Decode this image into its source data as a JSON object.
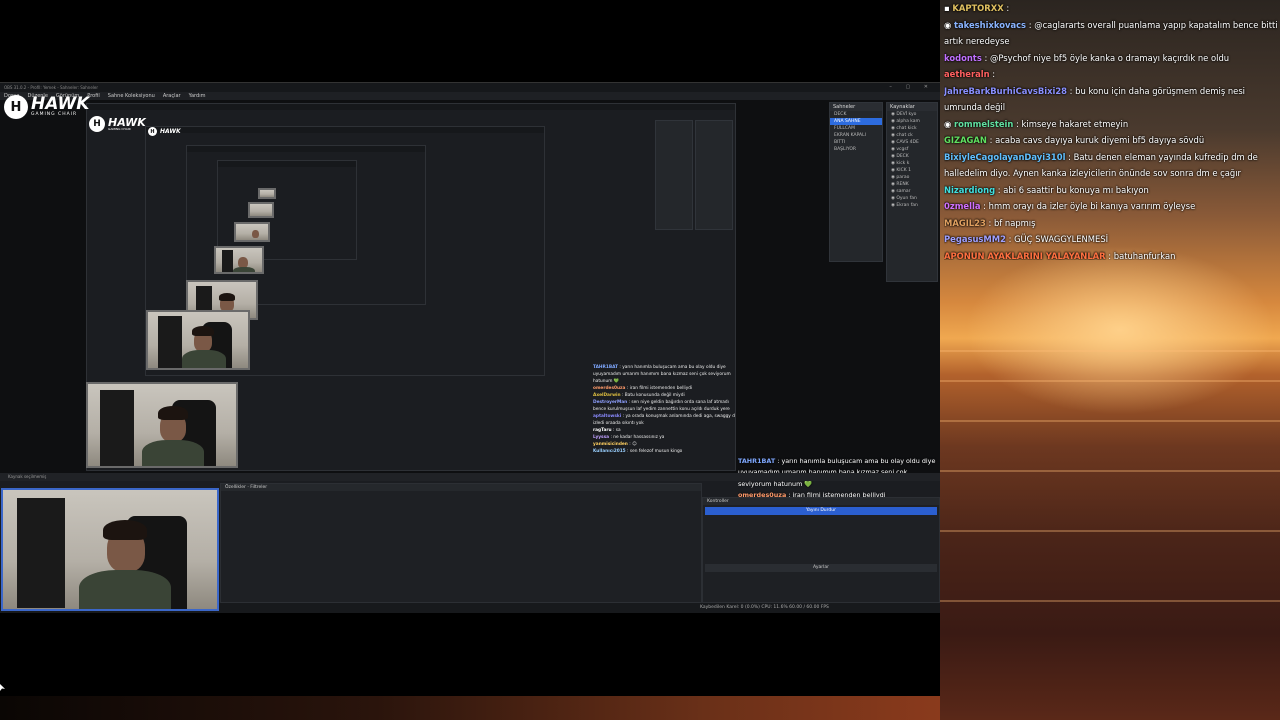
{
  "obs": {
    "title": "OBS 31.0.2 - Profil: Yemek - Sahneler: Sahneler",
    "window_controls": "–  ▢  ✕",
    "menu": [
      "Dosya",
      "Düzenle",
      "Görünüm",
      "Profil",
      "Sahne Koleksiyonu",
      "Araçlar",
      "Yardım"
    ],
    "controls_label": "Kaynak seçilmemiş",
    "dock_sources": "Kaynak seçilmemiş",
    "dock_filters": "Özellikler",
    "dock_filters2": "Filtreler",
    "dock_controls": "Kontroller",
    "status": "Kaybedilen Karel: 0 (0.0%)   CPU: 11.6%   60.00 / 60.00 FPS",
    "dock_record_button": "Yayını Durdur",
    "dock_settings_button": "Ayarlar",
    "scenes_title": "Sahneler",
    "sources_title": "Kaynaklar",
    "scenes": [
      "DECK",
      "ANA SAHNE",
      "FULLCAM",
      "EKRAN KAPALI",
      "BITTI",
      "BAŞLIYOR"
    ],
    "selected_scene_index": 1,
    "sources": [
      "DEVİ kyo",
      "alpha kam",
      "chat kick",
      "chat ck",
      "CAVS 4DE",
      "vcgsf",
      "DECK",
      "kick k",
      "KICK 1",
      "parao",
      "RENK",
      "samar",
      "Oyun fan",
      "Ekran fan"
    ]
  },
  "logo": {
    "name": "HAWK",
    "tagline": "GAMING CHAIR",
    "mark": "H"
  },
  "main_chat": [
    {
      "user": "KAPTORXX",
      "color": "#e0c060",
      "text": "",
      "badge": "▪"
    },
    {
      "user": "takeshixkovacs",
      "color": "#8ab4ff",
      "text": "@caglararts overall puanlama yapıp kapatalım bence bitti artık neredeyse",
      "badge": "◉"
    },
    {
      "user": "kodonts",
      "color": "#c070ff",
      "text": "@Psychof niye bf5 öyle kanka o dramayı kaçırdık ne oldu",
      "badge": ""
    },
    {
      "user": "aetheraln",
      "color": "#ff6060",
      "text": "",
      "badge": ""
    },
    {
      "user": "JahreBarkBurhiCavsBixi28",
      "color": "#8a90ff",
      "text": "bu konu için daha görüşmem demiş nesi umrunda değil",
      "badge": ""
    },
    {
      "user": "rommelstein",
      "color": "#60e0a0",
      "text": "kimseye hakaret etmeyin",
      "badge": "◉"
    },
    {
      "user": "GIZAGAN",
      "color": "#60e060",
      "text": "acaba cavs dayıya kuruk diyemi bf5 dayıya sövdü",
      "badge": ""
    },
    {
      "user": "BixiyleCagolayanDayi310l",
      "color": "#60c0ff",
      "text": "Batu denen eleman yayında kufredip dm de halledelim diyo. Aynen kanka izleyicilerin önünde sov sonra dm e çağır",
      "badge": ""
    },
    {
      "user": "Nizardiong",
      "color": "#40e0e0",
      "text": "abi 6 saattir bu konuya mı bakıyon",
      "badge": ""
    },
    {
      "user": "0zmella",
      "color": "#d070ff",
      "text": "hmm orayı da izler öyle bi kanıya varırım öyleyse",
      "badge": ""
    },
    {
      "user": "MAGIL23",
      "color": "#e0a060",
      "text": "bf napmış",
      "badge": ""
    },
    {
      "user": "PegasusMM2",
      "color": "#a0a0ff",
      "text": "GÜÇ SWAGGYLENMESİ",
      "badge": ""
    },
    {
      "user": "APONUN AYAKLARINI YALAYANLAR",
      "color": "#ff7040",
      "text": "batuhanfurkan",
      "badge": ""
    }
  ],
  "obs_chat": [
    {
      "user": "TAHR1BAT",
      "color": "#7fa8ff",
      "text": "yarın hanımla buluşucam ama bu olay oldu diye uyuyamadım umarım hanımım bana kızmaz seni çok seviyorum hatunum 💚"
    },
    {
      "user": "omerdes0uza",
      "color": "#ff9a6a",
      "text": "iran filmi istemenden belliydi"
    },
    {
      "user": "AxelDarwin",
      "color": "#e0c040",
      "text": "Batu konusunda değil miydi"
    },
    {
      "user": "DestroyerMan",
      "color": "#8fa0ff",
      "text": "sen niye geldin bağırdın orda sana laf atmadı bence kurulmuşsun laf yedim zannettin konu açıldı durduk yere"
    },
    {
      "user": "aptaltowski",
      "color": "#8a8aff",
      "text": "ya orada konuşmak anlamında dedi aga, swaggy de izledi oraada sıkıntı yok"
    },
    {
      "user": "ragTaru",
      "color": "#ffffff",
      "text": "sa"
    },
    {
      "user": "Lyyssa",
      "color": "#c0a0ff",
      "text": "ne kadar hassassınız ya"
    },
    {
      "user": "yanmisicinden",
      "color": "#ffd060",
      "text": "☺"
    },
    {
      "user": "Kullanıcı2015",
      "color": "#9ad0ff",
      "text": "sen felezof musun kingo"
    }
  ]
}
